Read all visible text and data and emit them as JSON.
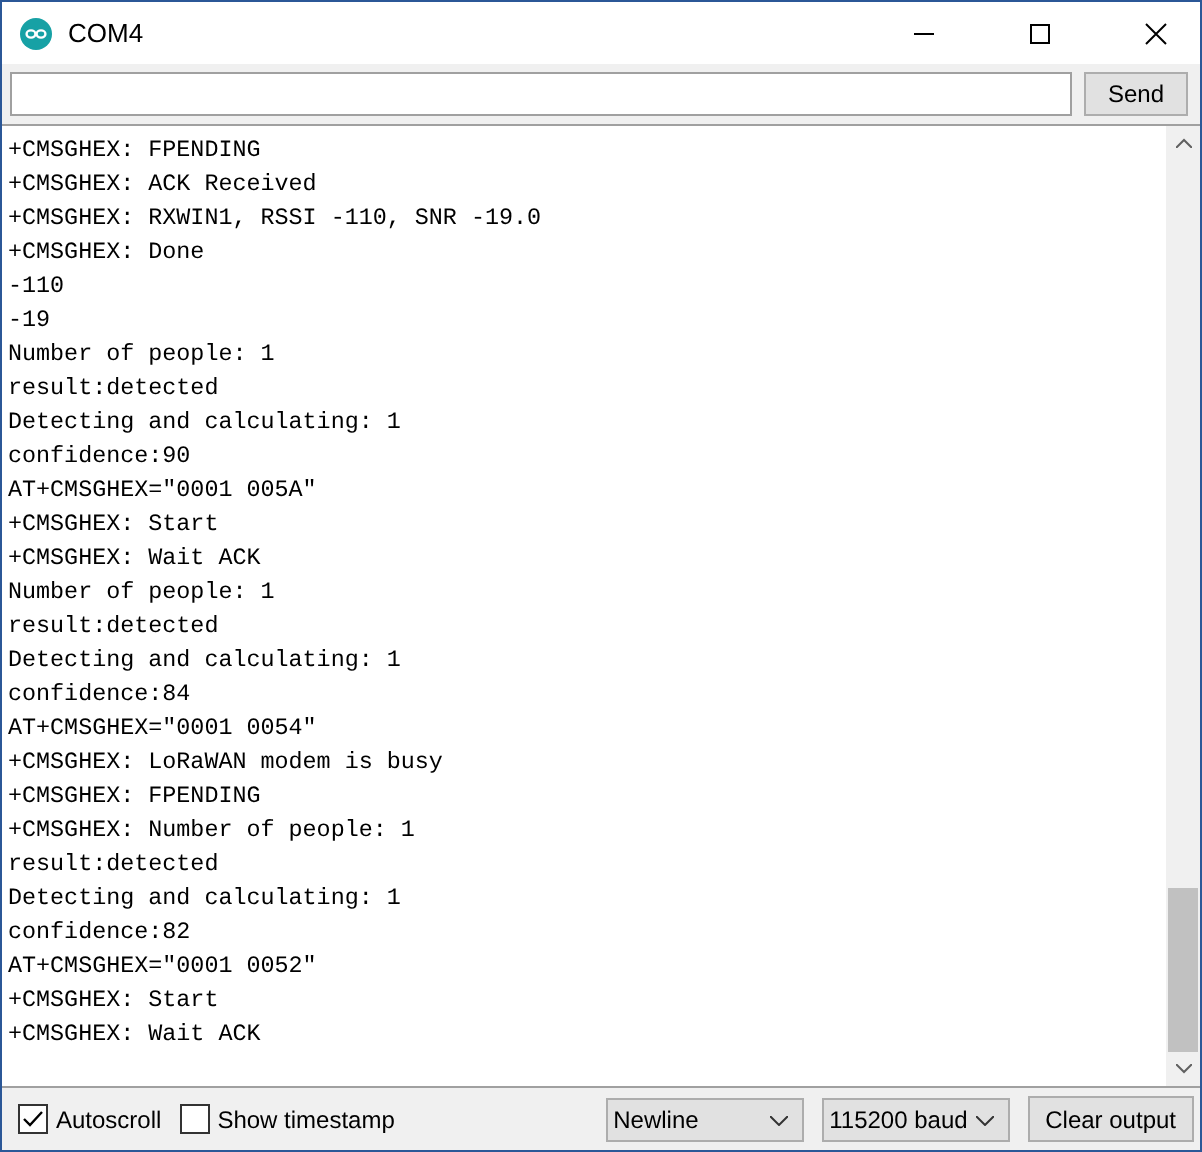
{
  "window": {
    "title": "COM4"
  },
  "send_button": "Send",
  "output_lines": [
    "+CMSGHEX: FPENDING",
    "+CMSGHEX: ACK Received",
    "+CMSGHEX: RXWIN1, RSSI -110, SNR -19.0",
    "+CMSGHEX: Done",
    "-110",
    "-19",
    "Number of people: 1",
    "result:detected",
    "Detecting and calculating: 1",
    "confidence:90",
    "AT+CMSGHEX=\"0001 005A\"",
    "+CMSGHEX: Start",
    "+CMSGHEX: Wait ACK",
    "Number of people: 1",
    "result:detected",
    "Detecting and calculating: 1",
    "confidence:84",
    "AT+CMSGHEX=\"0001 0054\"",
    "+CMSGHEX: LoRaWAN modem is busy",
    "+CMSGHEX: FPENDING",
    "+CMSGHEX: Number of people: 1",
    "result:detected",
    "Detecting and calculating: 1",
    "confidence:82",
    "AT+CMSGHEX=\"0001 0052\"",
    "+CMSGHEX: Start",
    "+CMSGHEX: Wait ACK"
  ],
  "autoscroll": {
    "label": "Autoscroll",
    "checked": true
  },
  "show_timestamp": {
    "label": "Show timestamp",
    "checked": false
  },
  "line_ending": "Newline",
  "baud_rate": "115200 baud",
  "clear_button": "Clear output"
}
